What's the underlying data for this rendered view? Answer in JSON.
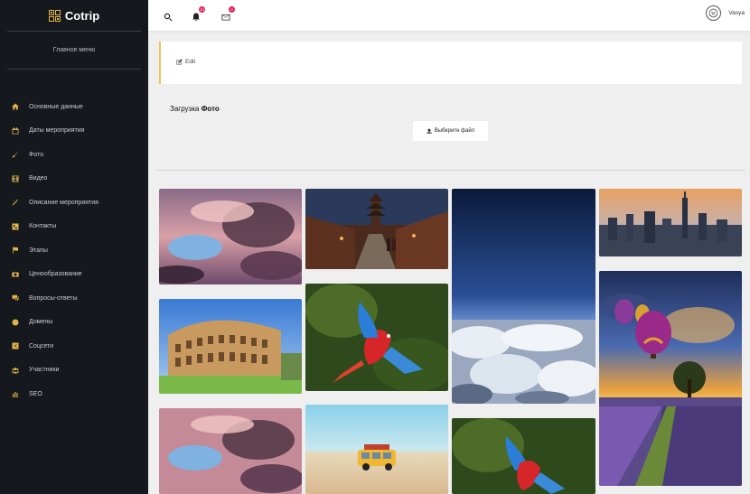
{
  "app": {
    "name": "Cotrip"
  },
  "sidebar": {
    "main_menu_label": "Главное меню",
    "items": [
      {
        "label": "Основные данные",
        "icon": "home-icon"
      },
      {
        "label": "Даты мероприятия",
        "icon": "calendar-icon"
      },
      {
        "label": "Фото",
        "icon": "brush-icon"
      },
      {
        "label": "Видео",
        "icon": "film-icon"
      },
      {
        "label": "Описание мероприятия",
        "icon": "magic-wand-icon"
      },
      {
        "label": "Контакты",
        "icon": "phone-icon"
      },
      {
        "label": "Этапы",
        "icon": "flag-icon"
      },
      {
        "label": "Ценообразование",
        "icon": "money-icon"
      },
      {
        "label": "Вопросы-ответы",
        "icon": "chat-icon"
      },
      {
        "label": "Домены",
        "icon": "globe-icon"
      },
      {
        "label": "Соцсети",
        "icon": "share-icon"
      },
      {
        "label": "Участники",
        "icon": "users-icon"
      },
      {
        "label": "SEO",
        "icon": "bar-chart-icon"
      }
    ],
    "accent_color": "#e0b44c"
  },
  "topbar": {
    "notifications_count": "13",
    "messages_count": "0",
    "username": "Vasya"
  },
  "content": {
    "edit_label": "Edit",
    "upload_title_prefix": "Загрузка",
    "upload_title_bold": "Фото",
    "upload_button_label": "Выберите файл"
  },
  "gallery": [
    {
      "name": "photo-clouds-pink"
    },
    {
      "name": "photo-japan-street"
    },
    {
      "name": "photo-sky-above-clouds"
    },
    {
      "name": "photo-city-skyline"
    },
    {
      "name": "photo-colosseum"
    },
    {
      "name": "photo-parrot"
    },
    {
      "name": "photo-hot-air-balloons"
    },
    {
      "name": "photo-clouds-pink-2"
    },
    {
      "name": "photo-toy-van-beach"
    },
    {
      "name": "photo-parrot-2"
    }
  ]
}
